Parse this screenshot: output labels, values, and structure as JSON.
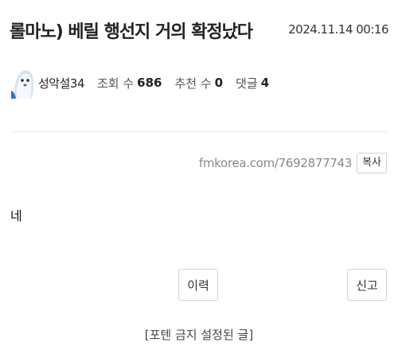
{
  "header": {
    "title": "롤마노) 베릴 행선지 거의 확정났다",
    "date": "2024.11.14 00:16"
  },
  "meta": {
    "avatar_icon": "seal-avatar-icon",
    "author": "성악설34",
    "views_label": "조회 수",
    "views_value": "686",
    "votes_label": "추천 수",
    "votes_value": "0",
    "comments_label": "댓글",
    "comments_value": "4"
  },
  "url_bar": {
    "url": "fmkorea.com/7692877743",
    "copy_label": "복사"
  },
  "content": {
    "body": "네"
  },
  "actions": {
    "history_label": "이력",
    "report_label": "신고"
  },
  "notice": "[포텐 금지 설정된 글]",
  "colors": {
    "text": "#222222",
    "muted": "#888888",
    "border": "#d4d4d4"
  }
}
